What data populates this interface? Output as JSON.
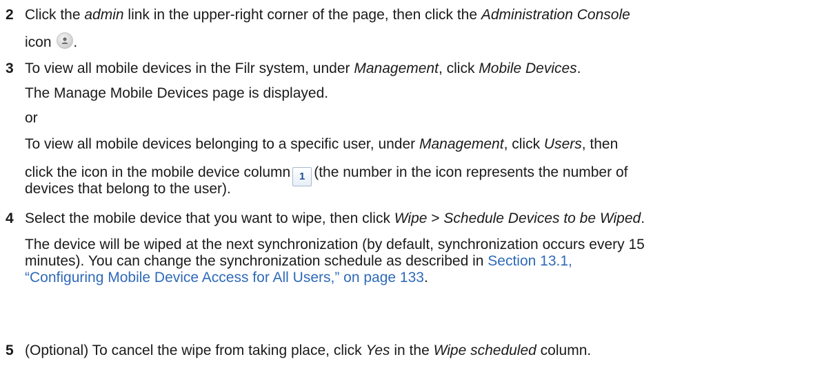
{
  "step2": {
    "num": "2",
    "t1": "Click the ",
    "admin": "admin",
    "t2": " link in the upper-right corner of the page, then click the ",
    "console": "Administration Console",
    "t3": "icon",
    "t4": ".",
    "icon": "admin-console-icon"
  },
  "step3": {
    "num": "3",
    "t1": "To view all mobile devices in the Filr system, under ",
    "management": "Management",
    "t2": ", click ",
    "mobile_devices": "Mobile Devices",
    "t3": ".",
    "p2": "The Manage Mobile Devices page is displayed.",
    "p3": "or",
    "p4a": "To view all mobile devices belonging to a specific user, under ",
    "p4_management": "Management",
    "p4b": ", click ",
    "p4_users": "Users",
    "p4c": ", then",
    "p5a": "click the icon in the mobile device column",
    "device_count": "1",
    "p5b": "(the number in the icon represents the number of",
    "p6": "devices that belong to the user)."
  },
  "step4": {
    "num": "4",
    "t1": "Select the mobile device that you want to wipe, then click ",
    "wipe": "Wipe",
    "t2": " > ",
    "schedule": "Schedule Devices to be Wiped",
    "t3": ".",
    "p2": "The device will be wiped at the next synchronization (by default, synchronization occurs every 15",
    "p3a": "minutes). You can change the synchronization schedule as described in ",
    "link1": "Section 13.1,",
    "link2": "“Configuring Mobile Device Access for All Users,” on page 133",
    "p4b": "."
  },
  "step5": {
    "num": "5",
    "t1": "(Optional) To cancel the wipe from taking place, click ",
    "yes": "Yes",
    "t2": " in the ",
    "wipe_scheduled": "Wipe scheduled",
    "t3": " column."
  },
  "colors": {
    "text": "#1a1a1a",
    "link": "#2e6ab8",
    "count_text": "#1d4f91"
  }
}
